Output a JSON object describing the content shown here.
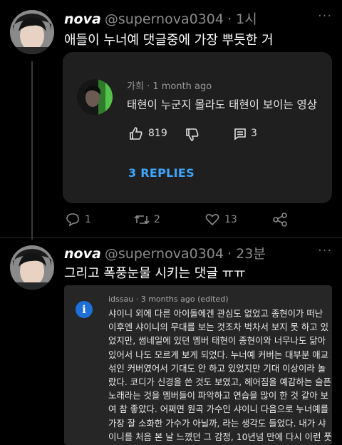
{
  "tweet1": {
    "name": "nova",
    "handle": "@supernova0304",
    "time": "· 1시",
    "text": "애들이 누너예 댓글중에 가장 뿌듯한 거",
    "more": "···"
  },
  "yt_card": {
    "author": "가희",
    "time": "· 1 month ago",
    "comment": "태현이 누군지 몰라도 태현이 보이는 영상",
    "likes": "819",
    "reply_count": "3",
    "replies_label": "3 REPLIES"
  },
  "actions1": {
    "replies": "1",
    "retweets": "2",
    "likes": "13"
  },
  "tweet2": {
    "name": "nova",
    "handle": "@supernova0304",
    "time": "· 23분",
    "text": "그리고 폭풍눈물 시키는 댓글 ㅠㅠ",
    "more": "···"
  },
  "card2": {
    "icon_letter": "i",
    "meta": "idssau · 3 months ago (edited)",
    "lines": [
      "샤이니 외에 다른 아이돌에겐 관심도 없었고 종현이가 떠난",
      "이후엔 샤이니의 무대를 보는 것조차 벅차서 보지 못 하고 있",
      "었지만, 썸네일에 있던 멤버 태현이 종현이와 너무나도 닮아",
      "있어서 나도 모르게 보게 되었다. 누너예 커버는 대부분 애교",
      "섞인 커버였어서 기대도 안 하고 있었지만 기대 이상이라 놀",
      "랐다. 코디가 신경을 쓴 것도 보였고, 헤어짐을 예감하는 슬픈",
      "노래라는 것을 멤버들이 파악하고 연습을 많이 한 것 같아 보",
      "여 참 좋았다. 어쩌면 원곡 가수인 샤이니 다음으로 누너예를",
      "가장 잘 소화한 가수가 아닐까, 라는 생각도 들었다. 내가 샤",
      "이니를 처음 본 날 느꼈던 그 감정, 10년넘 만에 다시 이런 풋"
    ]
  }
}
